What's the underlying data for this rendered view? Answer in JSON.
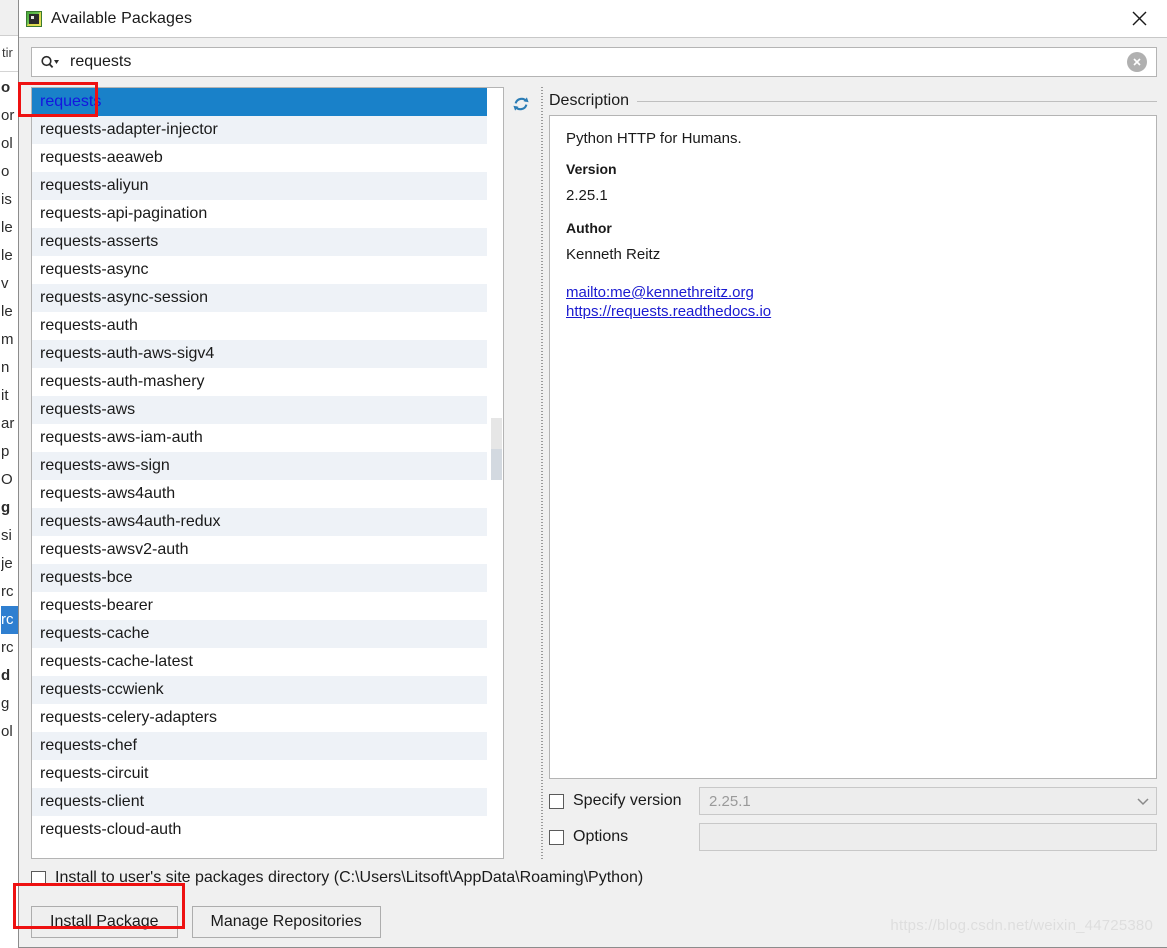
{
  "window": {
    "title": "Available Packages",
    "icon": "package-icon",
    "close_icon": "close-icon"
  },
  "search": {
    "value": "requests",
    "placeholder": "",
    "icon": "search-icon",
    "clear_icon": "clear-icon"
  },
  "list": {
    "selected": "requests",
    "refresh_icon": "refresh-icon",
    "items": [
      "requests",
      "requests-adapter-injector",
      "requests-aeaweb",
      "requests-aliyun",
      "requests-api-pagination",
      "requests-asserts",
      "requests-async",
      "requests-async-session",
      "requests-auth",
      "requests-auth-aws-sigv4",
      "requests-auth-mashery",
      "requests-aws",
      "requests-aws-iam-auth",
      "requests-aws-sign",
      "requests-aws4auth",
      "requests-aws4auth-redux",
      "requests-awsv2-auth",
      "requests-bce",
      "requests-bearer",
      "requests-cache",
      "requests-cache-latest",
      "requests-ccwienk",
      "requests-celery-adapters",
      "requests-chef",
      "requests-circuit",
      "requests-client",
      "requests-cloud-auth"
    ]
  },
  "description": {
    "header": "Description",
    "summary": "Python HTTP for Humans.",
    "version_label": "Version",
    "version_value": "2.25.1",
    "author_label": "Author",
    "author_value": "Kenneth Reitz",
    "links": [
      "mailto:me@kennethreitz.org",
      "https://requests.readthedocs.io"
    ]
  },
  "options": {
    "specify_version_label": "Specify version",
    "specify_version_value": "2.25.1",
    "specify_version_checked": false,
    "options_label": "Options",
    "options_value": "",
    "options_checked": false,
    "dropdown_icon": "chevron-down-icon"
  },
  "footer": {
    "install_user_label": "Install to user's site packages directory (C:\\Users\\Litsoft\\AppData\\Roaming\\Python)",
    "install_user_checked": false,
    "install_button": "Install Package",
    "manage_button": "Manage Repositories"
  },
  "watermark": "https://blog.csdn.net/weixin_44725380",
  "background_strip": {
    "tab_text": "tir",
    "lines": [
      "o",
      "or",
      "ol",
      "o",
      "is",
      "le",
      "le",
      "v",
      "le",
      "m",
      "n",
      "it",
      "ar",
      "p",
      "O",
      "g",
      "si",
      "je",
      "rc",
      "rc",
      "rc",
      "d",
      "g",
      "ol"
    ],
    "selected_index": 19
  },
  "colors": {
    "selection_blue": "#1981c9",
    "link_blue": "#1a1ad0",
    "annotation_red": "#ee1111",
    "row_stripe": "#eef2f7"
  }
}
